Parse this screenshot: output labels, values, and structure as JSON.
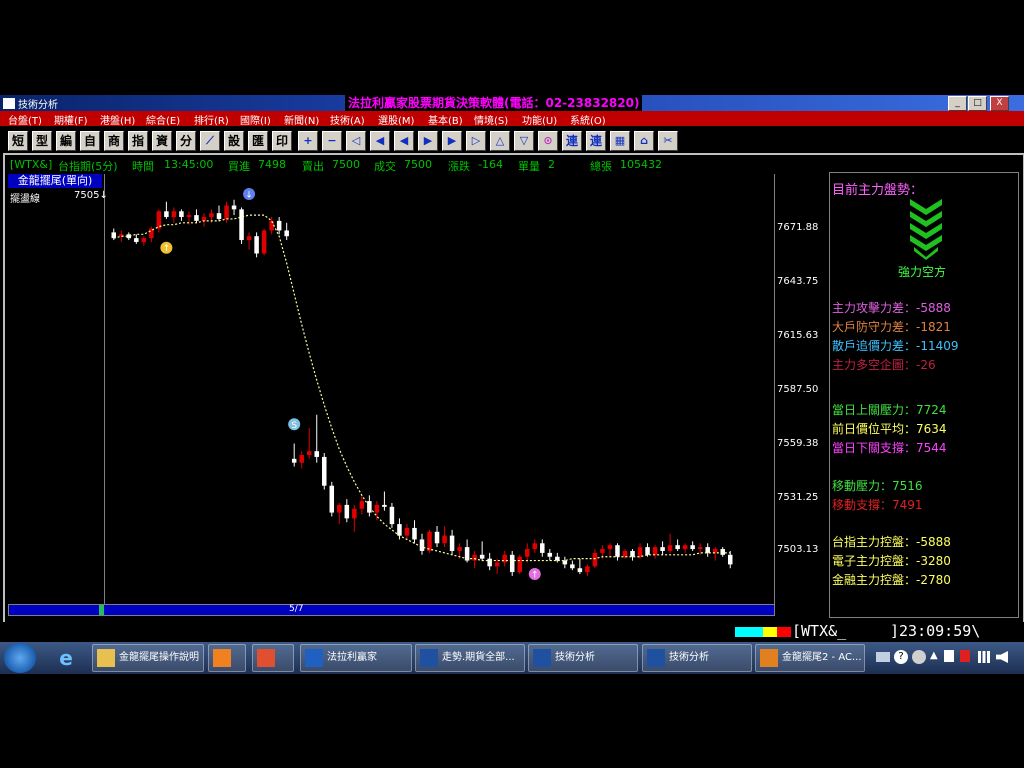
{
  "window": {
    "app_title": "技術分析",
    "marquee_text": "法拉利贏家股票期貨決策軟體(電話：02-23832820)",
    "buttons": [
      "_",
      "□",
      "X"
    ]
  },
  "menu": [
    "台盤(T)",
    "期權(F)",
    "港盤(H)",
    "綜合(E)",
    "排行(R)",
    "國際(I)",
    "新聞(N)",
    "技術(A)",
    "選股(M)",
    "基本(B)",
    "情境(S)",
    "功能(U)",
    "系統(O)"
  ],
  "toolbar": {
    "text_buttons": [
      "短",
      "型",
      "編",
      "自",
      "商",
      "指",
      "資",
      "分",
      "⟋",
      "設",
      "匯",
      "印"
    ],
    "icon_buttons": [
      "+",
      "−",
      "◁",
      "◀",
      "◀",
      "▶",
      "▶",
      "▷",
      "△",
      "▽",
      "⊙",
      "連",
      "連",
      "▦",
      "⌂",
      "✂"
    ]
  },
  "info": {
    "symbol": "[WTX&]",
    "name": "台指期(5分)",
    "time_label": "時間",
    "time": "13:45:00",
    "bid_label": "買進",
    "bid": "7498",
    "ask_label": "賣出",
    "ask": "7500",
    "deal_label": "成交",
    "deal": "7500",
    "change_label": "漲跌",
    "change": "-164",
    "vol_label": "單量",
    "vol": "2",
    "total_label": "總張",
    "total": "105432"
  },
  "left_panel": {
    "indicator_title": "金龍擺尾(單向)",
    "line_label": "擺盪線",
    "line_value": "7505↓"
  },
  "axis": {
    "ticks": [
      "7671.88",
      "7643.75",
      "7615.63",
      "7587.50",
      "7559.38",
      "7531.25",
      "7503.13"
    ],
    "date_label": "5/7"
  },
  "right_panel": {
    "header": "目前主力盤勢：",
    "trend_label": "強力空方",
    "rows": [
      {
        "label": "主力攻擊力差：",
        "value": "-5888",
        "color": "#e060e0"
      },
      {
        "label": "大戶防守力差：",
        "value": "-1821",
        "color": "#e08040"
      },
      {
        "label": "散戶追價力差：",
        "value": "-11409",
        "color": "#40c0ff"
      },
      {
        "label": "主力多空企圖：",
        "value": "-26",
        "color": "#c02040"
      },
      {
        "label": "當日上關壓力：",
        "value": "7724",
        "color": "#40e040"
      },
      {
        "label": "前日價位平均：",
        "value": "7634",
        "color": "#ffff60"
      },
      {
        "label": "當日下關支撐：",
        "value": "7544",
        "color": "#ff40ff"
      },
      {
        "label": "移動壓力：",
        "value": "7516",
        "color": "#40e040"
      },
      {
        "label": "移動支撐：",
        "value": "7491",
        "color": "#e02020"
      },
      {
        "label": "台指主力控盤：",
        "value": "-5888",
        "color": "#ffff60"
      },
      {
        "label": "電子主力控盤：",
        "value": "-3280",
        "color": "#ffff60"
      },
      {
        "label": "金融主力控盤：",
        "value": "-2780",
        "color": "#ffff60"
      }
    ]
  },
  "status": {
    "symbol": "[WTX&_",
    "clock": "]23:09:59\\"
  },
  "taskbar": {
    "items": [
      "金龍擺尾操作說明",
      "",
      "",
      "法拉利贏家",
      "走勢.期貨全部...",
      "技術分析",
      "技術分析",
      "金龍擺尾2 - AC..."
    ]
  },
  "colors": {
    "up": "#e00000",
    "down": "#ffffff",
    "ma": "#ffffa0"
  },
  "chart_data": {
    "type": "candlestick",
    "ylim": [
      7494,
      7692
    ],
    "candles": [
      [
        7672,
        7674,
        7668,
        7669
      ],
      [
        7670,
        7673,
        7667,
        7671
      ],
      [
        7671,
        7672,
        7668,
        7669
      ],
      [
        7669,
        7671,
        7666,
        7667
      ],
      [
        7667,
        7670,
        7665,
        7669
      ],
      [
        7669,
        7675,
        7667,
        7674
      ],
      [
        7674,
        7684,
        7672,
        7683
      ],
      [
        7683,
        7688,
        7679,
        7680
      ],
      [
        7680,
        7685,
        7677,
        7683
      ],
      [
        7683,
        7684,
        7678,
        7680
      ],
      [
        7680,
        7683,
        7676,
        7681
      ],
      [
        7681,
        7684,
        7677,
        7678
      ],
      [
        7678,
        7682,
        7675,
        7680
      ],
      [
        7680,
        7684,
        7677,
        7682
      ],
      [
        7682,
        7686,
        7678,
        7679
      ],
      [
        7679,
        7688,
        7677,
        7686
      ],
      [
        7686,
        7689,
        7681,
        7684
      ],
      [
        7684,
        7685,
        7666,
        7668
      ],
      [
        7668,
        7672,
        7663,
        7670
      ],
      [
        7670,
        7672,
        7659,
        7661
      ],
      [
        7661,
        7674,
        7660,
        7673
      ],
      [
        7673,
        7680,
        7671,
        7678
      ],
      [
        7678,
        7680,
        7671,
        7673
      ],
      [
        7673,
        7677,
        7668,
        7670
      ],
      [
        7554,
        7562,
        7550,
        7552
      ],
      [
        7552,
        7558,
        7549,
        7556
      ],
      [
        7556,
        7570,
        7554,
        7558
      ],
      [
        7558,
        7577,
        7552,
        7555
      ],
      [
        7555,
        7557,
        7538,
        7540
      ],
      [
        7540,
        7542,
        7524,
        7526
      ],
      [
        7526,
        7531,
        7520,
        7530
      ],
      [
        7530,
        7533,
        7521,
        7523
      ],
      [
        7523,
        7530,
        7516,
        7528
      ],
      [
        7528,
        7535,
        7525,
        7532
      ],
      [
        7532,
        7535,
        7524,
        7526
      ],
      [
        7526,
        7532,
        7522,
        7530
      ],
      [
        7530,
        7537,
        7527,
        7529
      ],
      [
        7529,
        7531,
        7518,
        7520
      ],
      [
        7520,
        7523,
        7512,
        7514
      ],
      [
        7514,
        7520,
        7512,
        7518
      ],
      [
        7518,
        7522,
        7510,
        7512
      ],
      [
        7512,
        7515,
        7504,
        7506
      ],
      [
        7506,
        7517,
        7505,
        7516
      ],
      [
        7516,
        7519,
        7508,
        7510
      ],
      [
        7510,
        7519,
        7508,
        7514
      ],
      [
        7514,
        7517,
        7504,
        7506
      ],
      [
        7506,
        7510,
        7502,
        7508
      ],
      [
        7508,
        7512,
        7500,
        7501
      ],
      [
        7501,
        7506,
        7497,
        7504
      ],
      [
        7504,
        7511,
        7501,
        7502
      ],
      [
        7502,
        7505,
        7496,
        7498
      ],
      [
        7498,
        7502,
        7494,
        7500
      ],
      [
        7500,
        7506,
        7498,
        7504
      ],
      [
        7504,
        7506,
        7493,
        7495
      ],
      [
        7495,
        7504,
        7494,
        7503
      ],
      [
        7503,
        7510,
        7500,
        7507
      ],
      [
        7507,
        7512,
        7505,
        7510
      ],
      [
        7510,
        7512,
        7503,
        7505
      ],
      [
        7505,
        7507,
        7501,
        7503
      ],
      [
        7503,
        7505,
        7500,
        7501
      ],
      [
        7501,
        7503,
        7497,
        7499
      ],
      [
        7499,
        7501,
        7496,
        7497
      ],
      [
        7497,
        7502,
        7494,
        7495
      ],
      [
        7495,
        7499,
        7493,
        7498
      ],
      [
        7498,
        7507,
        7497,
        7505
      ],
      [
        7505,
        7509,
        7502,
        7507
      ],
      [
        7507,
        7510,
        7503,
        7509
      ],
      [
        7509,
        7510,
        7501,
        7503
      ],
      [
        7503,
        7507,
        7502,
        7506
      ],
      [
        7506,
        7507,
        7501,
        7503
      ],
      [
        7503,
        7510,
        7502,
        7508
      ],
      [
        7508,
        7510,
        7503,
        7504
      ],
      [
        7504,
        7509,
        7502,
        7508
      ],
      [
        7508,
        7511,
        7504,
        7506
      ],
      [
        7506,
        7515,
        7505,
        7509
      ],
      [
        7509,
        7512,
        7506,
        7507
      ],
      [
        7507,
        7510,
        7505,
        7509
      ],
      [
        7509,
        7511,
        7506,
        7507
      ],
      [
        7507,
        7510,
        7504,
        7508
      ],
      [
        7508,
        7510,
        7503,
        7505
      ],
      [
        7505,
        7508,
        7501,
        7507
      ],
      [
        7507,
        7508,
        7503,
        7504
      ],
      [
        7504,
        7506,
        7497,
        7499
      ]
    ],
    "ma": [
      7669,
      7670,
      7670,
      7671,
      7671,
      7673,
      7675,
      7676,
      7676,
      7677,
      7677,
      7677,
      7678,
      7678,
      7678,
      7679,
      7679,
      7680,
      7681,
      7681,
      7681,
      7678,
      7670,
      7656,
      7640,
      7624,
      7609,
      7595,
      7582,
      7570,
      7559,
      7550,
      7542,
      7535,
      7529,
      7524,
      7520,
      7517,
      7514,
      7512,
      7510,
      7508,
      7507,
      7506,
      7505,
      7504,
      7503,
      7502,
      7502,
      7501,
      7501,
      7501,
      7501,
      7501,
      7501,
      7501,
      7501,
      7501,
      7501,
      7501,
      7501,
      7502,
      7502,
      7502,
      7502,
      7503,
      7503,
      7503,
      7503,
      7503,
      7503,
      7504,
      7504,
      7504,
      7504,
      7504,
      7504,
      7504,
      7505,
      7505,
      7505,
      7505,
      7505
    ],
    "signals": [
      {
        "index": 7,
        "price": 7664,
        "type": "buy",
        "color": "#f0c030"
      },
      {
        "index": 18,
        "price": 7692,
        "type": "sell",
        "color": "#6080f0"
      },
      {
        "index": 24,
        "price": 7572,
        "type": "S",
        "color": "#80c0e0"
      },
      {
        "index": 56,
        "price": 7494,
        "type": "buy",
        "color": "#e070e0"
      }
    ]
  }
}
